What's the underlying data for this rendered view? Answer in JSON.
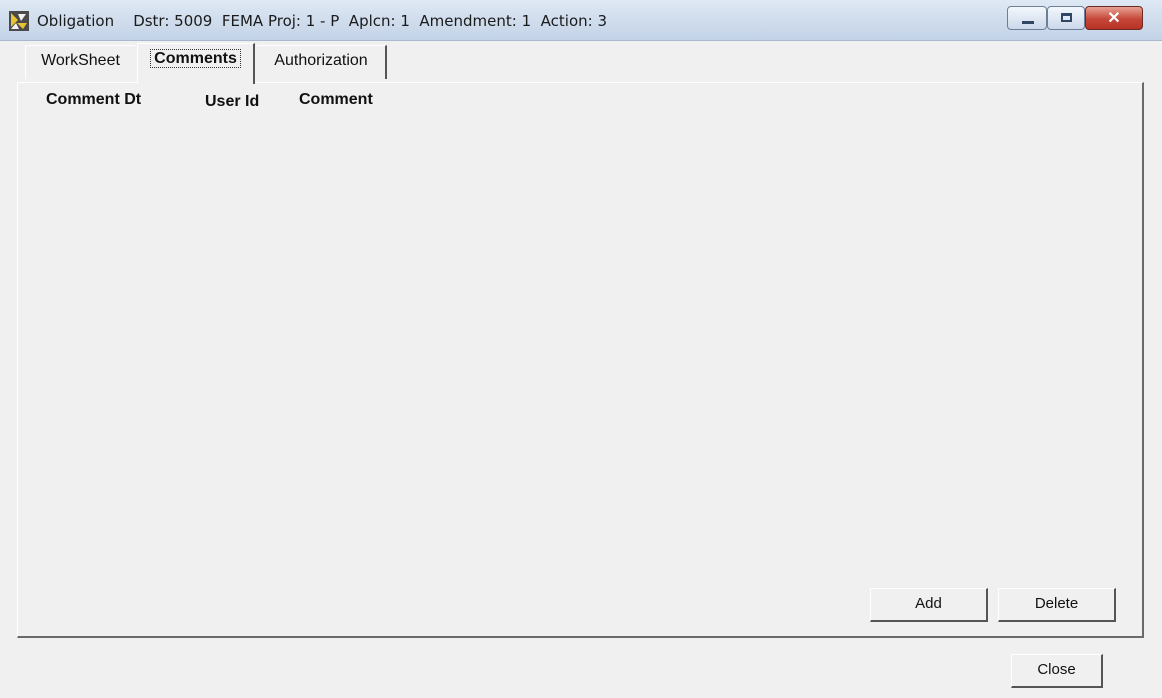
{
  "window": {
    "title_app": "Obligation",
    "title_details": "Dstr: 5009  FEMA Proj: 1 - P  Aplcn: 1  Amendment: 1  Action: 3",
    "icon": "app-icon",
    "controls": {
      "minimize": "minimize-icon",
      "maximize": "maximize-icon",
      "close": "✕"
    }
  },
  "tabs": [
    {
      "label": "WorkSheet",
      "active": false
    },
    {
      "label": "Comments",
      "active": true
    },
    {
      "label": "Authorization",
      "active": false
    }
  ],
  "comments_table": {
    "columns": [
      "Comment Dt",
      "User Id",
      "Comment"
    ],
    "rows": []
  },
  "buttons": {
    "add": "Add",
    "delete": "Delete",
    "close": "Close"
  }
}
